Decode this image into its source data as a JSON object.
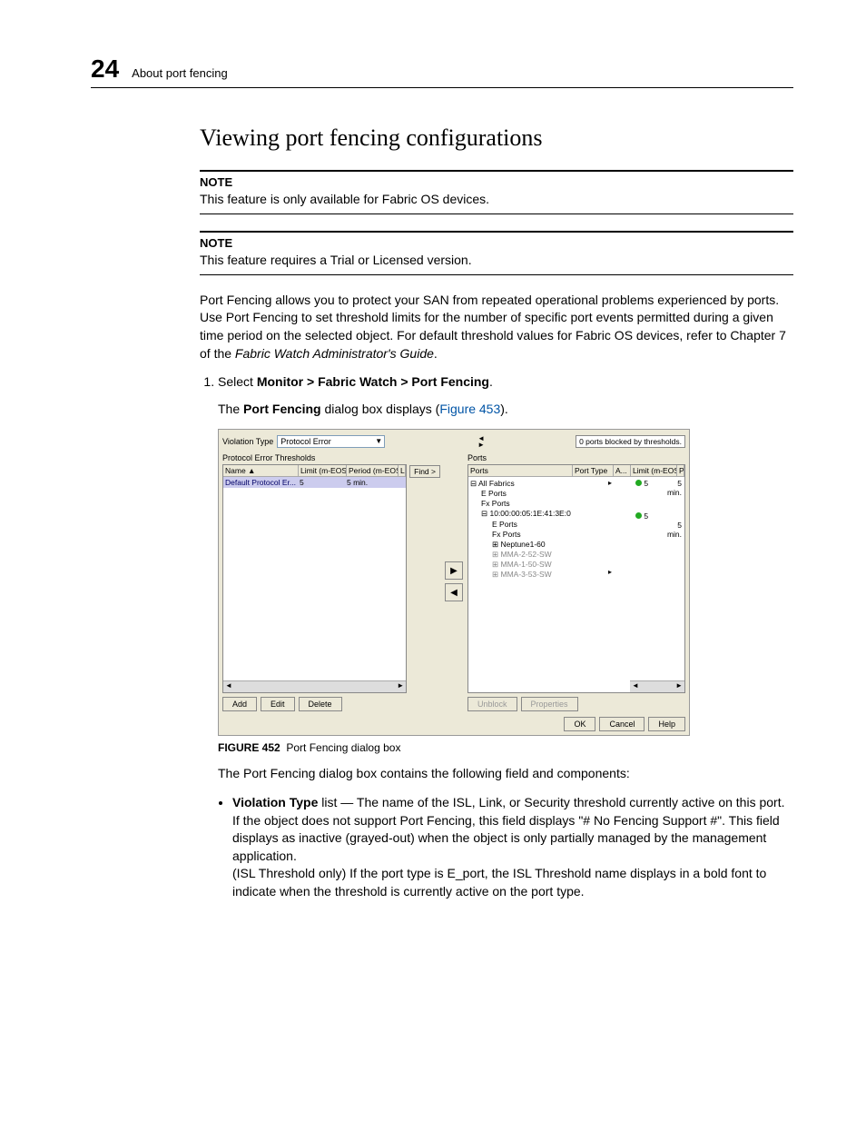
{
  "header": {
    "chapter_number": "24",
    "chapter_title": "About port fencing"
  },
  "section_heading": "Viewing port fencing configurations",
  "note1": {
    "label": "NOTE",
    "text": "This feature is only available for Fabric OS devices."
  },
  "note2": {
    "label": "NOTE",
    "text": "This feature requires a Trial or Licensed version."
  },
  "intro_para": "Port Fencing allows you to protect your SAN from repeated operational problems experienced by ports. Use Port Fencing to set threshold limits for the number of specific port events permitted during a given time period on the selected object. For default threshold values for Fabric OS devices, refer to Chapter 7 of the ",
  "intro_ital": "Fabric Watch Administrator's Guide",
  "intro_end": ".",
  "step1_pre": "Select ",
  "step1_bold": "Monitor > Fabric Watch > Port Fencing",
  "step1_post": ".",
  "step1_sub_pre": "The ",
  "step1_sub_bold": "Port Fencing",
  "step1_sub_mid": " dialog box displays (",
  "step1_sub_ref": "Figure 453",
  "step1_sub_end": ").",
  "figure": {
    "number": "FIGURE 452",
    "caption": "Port Fencing dialog box"
  },
  "post_fig_para": "The Port Fencing dialog box contains the following field and components:",
  "bullet1_term": "Violation Type",
  "bullet1_rest": " list — The name of the ISL, Link, or Security threshold currently active on this port. If the object does not support Port Fencing, this field displays \"# No Fencing Support #\". This field displays as inactive (grayed-out) when the object is only partially managed by the management application.",
  "bullet1_extra": "(ISL Threshold only) If the port type is E_port, the ISL Threshold name displays in a bold font to indicate when the threshold is currently active on the port type.",
  "dialog": {
    "violation_type_label": "Violation Type",
    "violation_type_value": "Protocol Error",
    "blocked_msg": "0 ports blocked by thresholds.",
    "left_title": "Protocol Error Thresholds",
    "left_cols": {
      "c0": "Name ▲",
      "c1": "Limit (m-EOS)",
      "c2": "Period (m-EOS)",
      "c3": "Limit (FOS)"
    },
    "left_row": {
      "name": "Default Protocol Er...",
      "limit": "5",
      "period": "5 min."
    },
    "find": "Find >",
    "right_title": "Ports",
    "right_cols": {
      "c0": "Ports",
      "c1": "Port Type",
      "c2": "A...",
      "c3": "Limit (m-EOS)",
      "c4": "Period (m-EO"
    },
    "tree": {
      "n0": "All Fabrics",
      "n1": "E Ports",
      "n2": "Fx Ports",
      "n3": "10:00:00:05:1E:41:3E:0",
      "n4": "E Ports",
      "n5": "Fx Ports",
      "n6": "Neptune1-60",
      "n7": "MMA-2-52-SW",
      "n8": "MMA-1-50-SW",
      "n9": "MMA-3-53-SW"
    },
    "right_vals": {
      "r0_limit": "5",
      "r0_period": "5 min.",
      "r3_limit": "5",
      "r3_period": "5 min."
    },
    "btns": {
      "add": "Add",
      "edit": "Edit",
      "delete": "Delete",
      "unblock": "Unblock",
      "properties": "Properties",
      "ok": "OK",
      "cancel": "Cancel",
      "help": "Help"
    }
  }
}
